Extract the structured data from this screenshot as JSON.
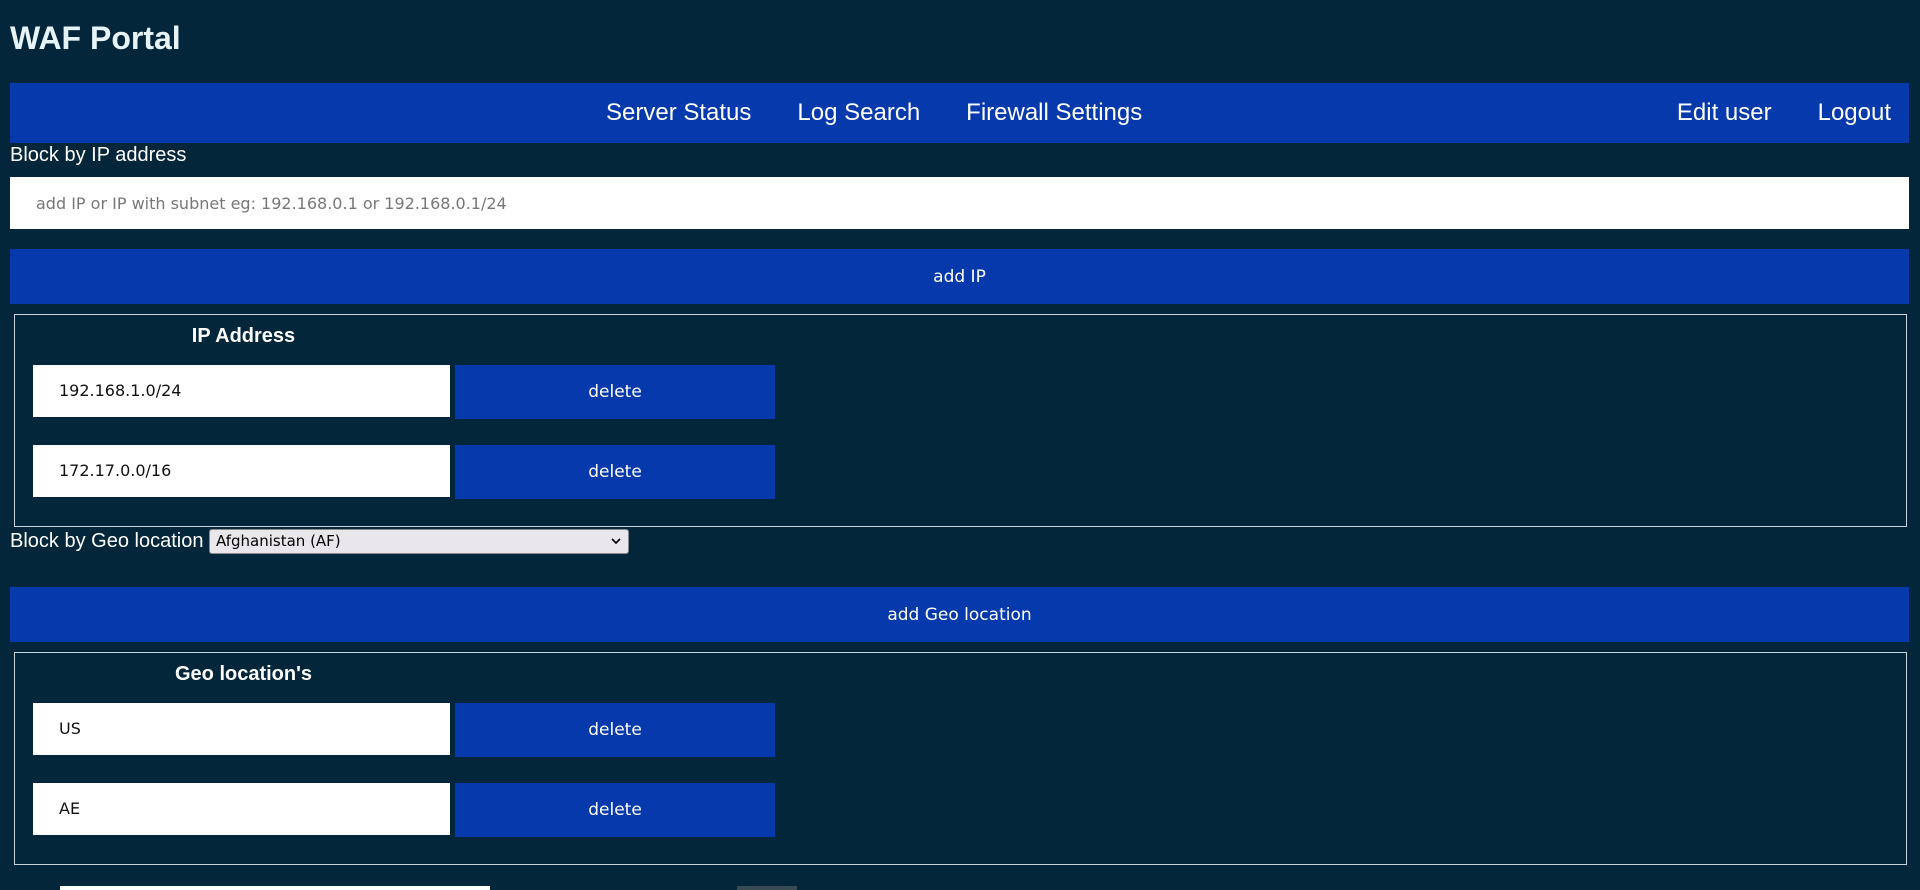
{
  "app": {
    "title": "WAF Portal"
  },
  "nav": {
    "center_links": [
      "Server Status",
      "Log Search",
      "Firewall Settings"
    ],
    "right_links": [
      "Edit user",
      "Logout"
    ]
  },
  "ip_block": {
    "label": "Block by IP address",
    "input_placeholder": "add IP or IP with subnet eg: 192.168.0.1 or 192.168.0.1/24",
    "input_value": "",
    "add_button": "add IP",
    "table_header": "IP Address",
    "entries": [
      {
        "value": "192.168.1.0/24",
        "delete_label": "delete"
      },
      {
        "value": "172.17.0.0/16",
        "delete_label": "delete"
      }
    ]
  },
  "geo_block": {
    "label": "Block by Geo location",
    "selected_option": "Afghanistan (AF)",
    "add_button": "add Geo location",
    "table_header": "Geo location's",
    "entries": [
      {
        "value": "US",
        "delete_label": "delete"
      },
      {
        "value": "AE",
        "delete_label": "delete"
      }
    ]
  },
  "colors": {
    "background": "#04263a",
    "accent_blue": "#0639ab",
    "text_white": "#ffffff"
  }
}
